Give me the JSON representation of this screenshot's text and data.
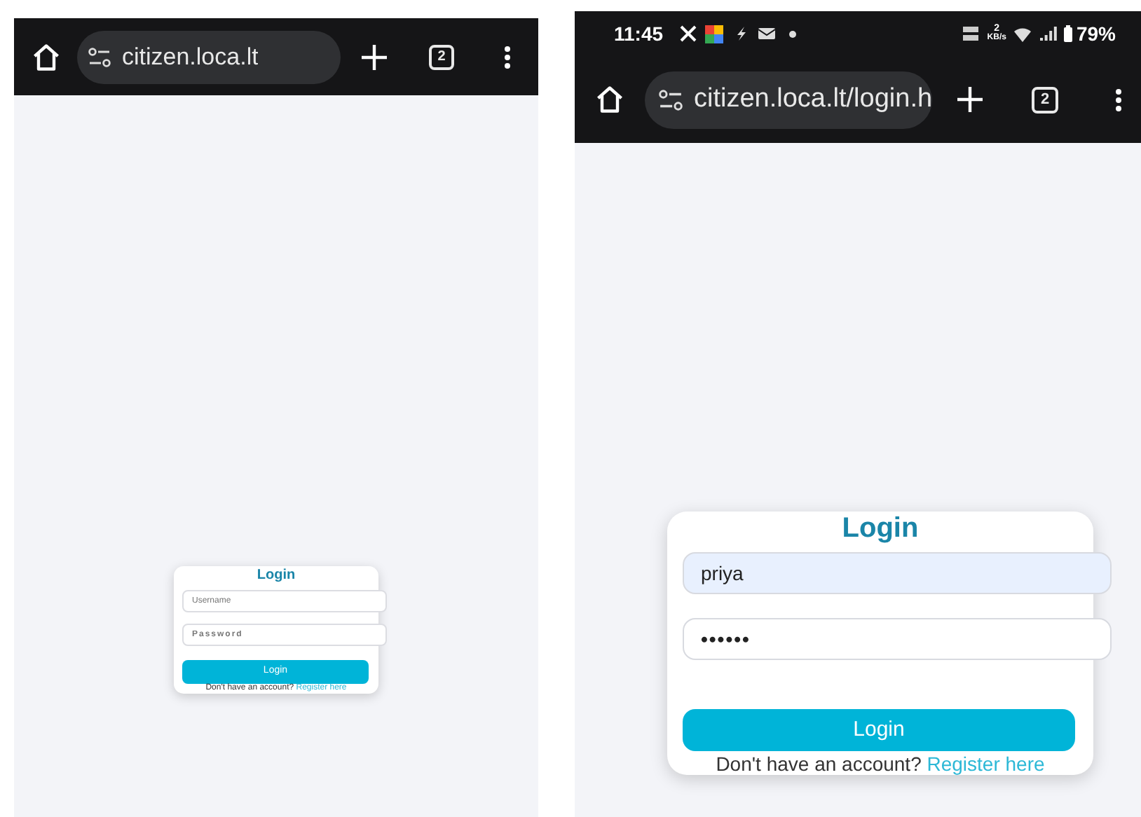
{
  "screens": [
    {
      "address_bar": {
        "url": "citizen.loca.lt"
      },
      "tab_count": "2",
      "login": {
        "title": "Login",
        "fields": [
          {
            "kind": "text",
            "placeholder": "Username",
            "autofilled": false
          },
          {
            "kind": "password",
            "placeholder": "Password",
            "autofilled": false
          }
        ],
        "button": "Login",
        "prompt": "Don't have an account?",
        "link": "Register here"
      }
    },
    {
      "status_bar": {
        "time": "11:45",
        "data_speed": "2",
        "data_unit": "KB/s",
        "battery": "79%"
      },
      "address_bar": {
        "url": "citizen.loca.lt/login.h"
      },
      "tab_count": "2",
      "login": {
        "title": "Login",
        "fields": [
          {
            "kind": "text",
            "value": "priya",
            "autofilled": true
          },
          {
            "kind": "password",
            "value": "••••••",
            "autofilled": false
          }
        ],
        "button": "Login",
        "prompt": "Don't have an account?",
        "link": "Register here"
      }
    }
  ]
}
